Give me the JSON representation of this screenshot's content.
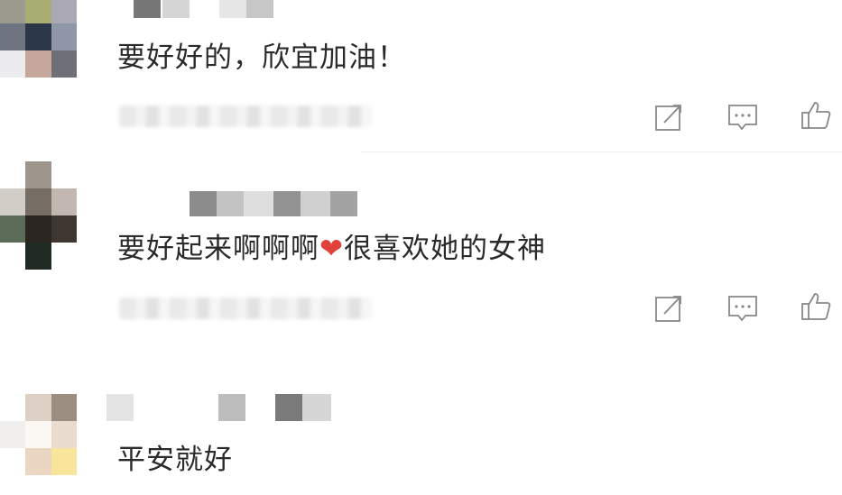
{
  "comments": [
    {
      "text": "要好好的，欣宜加油！"
    },
    {
      "text_before": "要好起来啊啊啊",
      "heart": "❤",
      "text_after": "很喜欢她的女神"
    },
    {
      "text": "平安就好"
    }
  ],
  "icons": {
    "share": "share-icon",
    "reply": "comment-icon",
    "like": "thumbs-up-icon"
  }
}
